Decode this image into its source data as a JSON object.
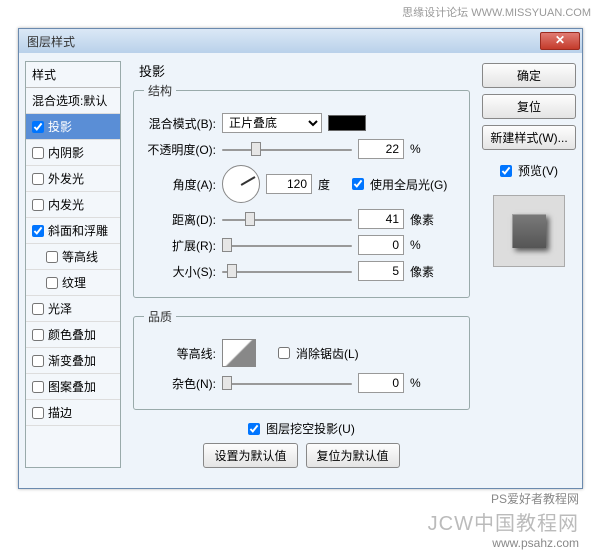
{
  "watermark_top": "思缘设计论坛  WWW.MISSYUAN.COM",
  "dialog": {
    "title": "图层样式"
  },
  "styles": {
    "header": "样式",
    "blend_header": "混合选项:默认",
    "items": [
      {
        "label": "投影",
        "checked": true,
        "sel": true
      },
      {
        "label": "内阴影",
        "checked": false
      },
      {
        "label": "外发光",
        "checked": false
      },
      {
        "label": "内发光",
        "checked": false
      },
      {
        "label": "斜面和浮雕",
        "checked": true
      },
      {
        "label": "等高线",
        "checked": false,
        "indent": true
      },
      {
        "label": "纹理",
        "checked": false,
        "indent": true
      },
      {
        "label": "光泽",
        "checked": false
      },
      {
        "label": "颜色叠加",
        "checked": false
      },
      {
        "label": "渐变叠加",
        "checked": false
      },
      {
        "label": "图案叠加",
        "checked": false
      },
      {
        "label": "描边",
        "checked": false
      }
    ]
  },
  "main": {
    "title": "投影",
    "structure": {
      "legend": "结构",
      "blend_label": "混合模式(B):",
      "blend_value": "正片叠底",
      "opacity_label": "不透明度(O):",
      "opacity_value": "22",
      "opacity_unit": "%",
      "angle_label": "角度(A):",
      "angle_value": "120",
      "angle_unit": "度",
      "global_label": "使用全局光(G)",
      "distance_label": "距离(D):",
      "distance_value": "41",
      "distance_unit": "像素",
      "spread_label": "扩展(R):",
      "spread_value": "0",
      "spread_unit": "%",
      "size_label": "大小(S):",
      "size_value": "5",
      "size_unit": "像素"
    },
    "quality": {
      "legend": "品质",
      "contour_label": "等高线:",
      "antialias_label": "消除锯齿(L)",
      "noise_label": "杂色(N):",
      "noise_value": "0",
      "noise_unit": "%"
    },
    "knockout_label": "图层挖空投影(U)",
    "make_default": "设置为默认值",
    "reset_default": "复位为默认值"
  },
  "right": {
    "ok": "确定",
    "reset": "复位",
    "new_style": "新建样式(W)...",
    "preview_label": "预览(V)"
  },
  "watermark_bottom": {
    "site": "PS爱好者教程网",
    "url": "www.psahz.com",
    "jc": "JCW中国教程网"
  }
}
